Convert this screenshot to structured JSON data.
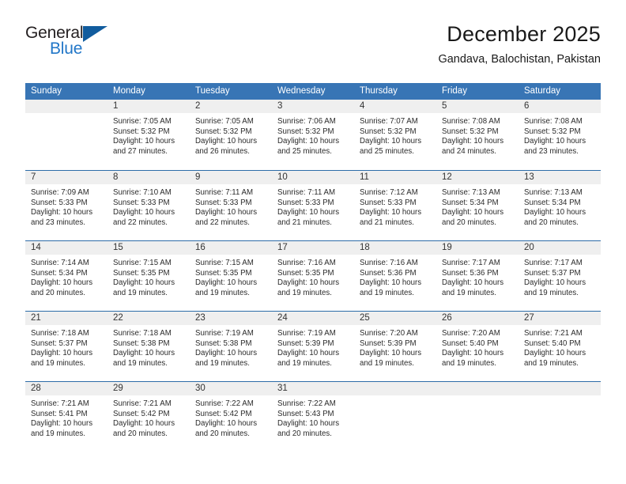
{
  "brand": {
    "name_part1": "General",
    "name_part2": "Blue",
    "accent_color": "#2277c8",
    "triangle_color": "#115c9e"
  },
  "header": {
    "month_title": "December 2025",
    "location": "Gandava, Balochistan, Pakistan"
  },
  "calendar": {
    "header_color": "#3875b5",
    "week_divider_color": "#2d6ca8",
    "day_number_band_color": "#efefef",
    "weekdays": [
      "Sunday",
      "Monday",
      "Tuesday",
      "Wednesday",
      "Thursday",
      "Friday",
      "Saturday"
    ],
    "weeks": [
      [
        {
          "day": "",
          "sunrise": "",
          "sunset": "",
          "daylight_line1": "",
          "daylight_line2": ""
        },
        {
          "day": "1",
          "sunrise": "Sunrise: 7:05 AM",
          "sunset": "Sunset: 5:32 PM",
          "daylight_line1": "Daylight: 10 hours",
          "daylight_line2": "and 27 minutes."
        },
        {
          "day": "2",
          "sunrise": "Sunrise: 7:05 AM",
          "sunset": "Sunset: 5:32 PM",
          "daylight_line1": "Daylight: 10 hours",
          "daylight_line2": "and 26 minutes."
        },
        {
          "day": "3",
          "sunrise": "Sunrise: 7:06 AM",
          "sunset": "Sunset: 5:32 PM",
          "daylight_line1": "Daylight: 10 hours",
          "daylight_line2": "and 25 minutes."
        },
        {
          "day": "4",
          "sunrise": "Sunrise: 7:07 AM",
          "sunset": "Sunset: 5:32 PM",
          "daylight_line1": "Daylight: 10 hours",
          "daylight_line2": "and 25 minutes."
        },
        {
          "day": "5",
          "sunrise": "Sunrise: 7:08 AM",
          "sunset": "Sunset: 5:32 PM",
          "daylight_line1": "Daylight: 10 hours",
          "daylight_line2": "and 24 minutes."
        },
        {
          "day": "6",
          "sunrise": "Sunrise: 7:08 AM",
          "sunset": "Sunset: 5:32 PM",
          "daylight_line1": "Daylight: 10 hours",
          "daylight_line2": "and 23 minutes."
        }
      ],
      [
        {
          "day": "7",
          "sunrise": "Sunrise: 7:09 AM",
          "sunset": "Sunset: 5:33 PM",
          "daylight_line1": "Daylight: 10 hours",
          "daylight_line2": "and 23 minutes."
        },
        {
          "day": "8",
          "sunrise": "Sunrise: 7:10 AM",
          "sunset": "Sunset: 5:33 PM",
          "daylight_line1": "Daylight: 10 hours",
          "daylight_line2": "and 22 minutes."
        },
        {
          "day": "9",
          "sunrise": "Sunrise: 7:11 AM",
          "sunset": "Sunset: 5:33 PM",
          "daylight_line1": "Daylight: 10 hours",
          "daylight_line2": "and 22 minutes."
        },
        {
          "day": "10",
          "sunrise": "Sunrise: 7:11 AM",
          "sunset": "Sunset: 5:33 PM",
          "daylight_line1": "Daylight: 10 hours",
          "daylight_line2": "and 21 minutes."
        },
        {
          "day": "11",
          "sunrise": "Sunrise: 7:12 AM",
          "sunset": "Sunset: 5:33 PM",
          "daylight_line1": "Daylight: 10 hours",
          "daylight_line2": "and 21 minutes."
        },
        {
          "day": "12",
          "sunrise": "Sunrise: 7:13 AM",
          "sunset": "Sunset: 5:34 PM",
          "daylight_line1": "Daylight: 10 hours",
          "daylight_line2": "and 20 minutes."
        },
        {
          "day": "13",
          "sunrise": "Sunrise: 7:13 AM",
          "sunset": "Sunset: 5:34 PM",
          "daylight_line1": "Daylight: 10 hours",
          "daylight_line2": "and 20 minutes."
        }
      ],
      [
        {
          "day": "14",
          "sunrise": "Sunrise: 7:14 AM",
          "sunset": "Sunset: 5:34 PM",
          "daylight_line1": "Daylight: 10 hours",
          "daylight_line2": "and 20 minutes."
        },
        {
          "day": "15",
          "sunrise": "Sunrise: 7:15 AM",
          "sunset": "Sunset: 5:35 PM",
          "daylight_line1": "Daylight: 10 hours",
          "daylight_line2": "and 19 minutes."
        },
        {
          "day": "16",
          "sunrise": "Sunrise: 7:15 AM",
          "sunset": "Sunset: 5:35 PM",
          "daylight_line1": "Daylight: 10 hours",
          "daylight_line2": "and 19 minutes."
        },
        {
          "day": "17",
          "sunrise": "Sunrise: 7:16 AM",
          "sunset": "Sunset: 5:35 PM",
          "daylight_line1": "Daylight: 10 hours",
          "daylight_line2": "and 19 minutes."
        },
        {
          "day": "18",
          "sunrise": "Sunrise: 7:16 AM",
          "sunset": "Sunset: 5:36 PM",
          "daylight_line1": "Daylight: 10 hours",
          "daylight_line2": "and 19 minutes."
        },
        {
          "day": "19",
          "sunrise": "Sunrise: 7:17 AM",
          "sunset": "Sunset: 5:36 PM",
          "daylight_line1": "Daylight: 10 hours",
          "daylight_line2": "and 19 minutes."
        },
        {
          "day": "20",
          "sunrise": "Sunrise: 7:17 AM",
          "sunset": "Sunset: 5:37 PM",
          "daylight_line1": "Daylight: 10 hours",
          "daylight_line2": "and 19 minutes."
        }
      ],
      [
        {
          "day": "21",
          "sunrise": "Sunrise: 7:18 AM",
          "sunset": "Sunset: 5:37 PM",
          "daylight_line1": "Daylight: 10 hours",
          "daylight_line2": "and 19 minutes."
        },
        {
          "day": "22",
          "sunrise": "Sunrise: 7:18 AM",
          "sunset": "Sunset: 5:38 PM",
          "daylight_line1": "Daylight: 10 hours",
          "daylight_line2": "and 19 minutes."
        },
        {
          "day": "23",
          "sunrise": "Sunrise: 7:19 AM",
          "sunset": "Sunset: 5:38 PM",
          "daylight_line1": "Daylight: 10 hours",
          "daylight_line2": "and 19 minutes."
        },
        {
          "day": "24",
          "sunrise": "Sunrise: 7:19 AM",
          "sunset": "Sunset: 5:39 PM",
          "daylight_line1": "Daylight: 10 hours",
          "daylight_line2": "and 19 minutes."
        },
        {
          "day": "25",
          "sunrise": "Sunrise: 7:20 AM",
          "sunset": "Sunset: 5:39 PM",
          "daylight_line1": "Daylight: 10 hours",
          "daylight_line2": "and 19 minutes."
        },
        {
          "day": "26",
          "sunrise": "Sunrise: 7:20 AM",
          "sunset": "Sunset: 5:40 PM",
          "daylight_line1": "Daylight: 10 hours",
          "daylight_line2": "and 19 minutes."
        },
        {
          "day": "27",
          "sunrise": "Sunrise: 7:21 AM",
          "sunset": "Sunset: 5:40 PM",
          "daylight_line1": "Daylight: 10 hours",
          "daylight_line2": "and 19 minutes."
        }
      ],
      [
        {
          "day": "28",
          "sunrise": "Sunrise: 7:21 AM",
          "sunset": "Sunset: 5:41 PM",
          "daylight_line1": "Daylight: 10 hours",
          "daylight_line2": "and 19 minutes."
        },
        {
          "day": "29",
          "sunrise": "Sunrise: 7:21 AM",
          "sunset": "Sunset: 5:42 PM",
          "daylight_line1": "Daylight: 10 hours",
          "daylight_line2": "and 20 minutes."
        },
        {
          "day": "30",
          "sunrise": "Sunrise: 7:22 AM",
          "sunset": "Sunset: 5:42 PM",
          "daylight_line1": "Daylight: 10 hours",
          "daylight_line2": "and 20 minutes."
        },
        {
          "day": "31",
          "sunrise": "Sunrise: 7:22 AM",
          "sunset": "Sunset: 5:43 PM",
          "daylight_line1": "Daylight: 10 hours",
          "daylight_line2": "and 20 minutes."
        },
        {
          "day": "",
          "sunrise": "",
          "sunset": "",
          "daylight_line1": "",
          "daylight_line2": ""
        },
        {
          "day": "",
          "sunrise": "",
          "sunset": "",
          "daylight_line1": "",
          "daylight_line2": ""
        },
        {
          "day": "",
          "sunrise": "",
          "sunset": "",
          "daylight_line1": "",
          "daylight_line2": ""
        }
      ]
    ]
  }
}
